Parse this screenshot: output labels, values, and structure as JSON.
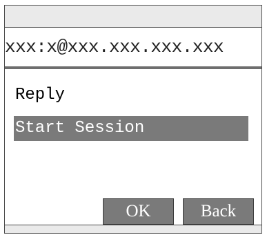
{
  "header": {
    "address": "xxx:x@xxx.xxx.xxx.xxx"
  },
  "menu": {
    "items": [
      {
        "label": "Reply",
        "selected": false
      },
      {
        "label": "Start Session",
        "selected": true
      }
    ]
  },
  "softkeys": {
    "ok_label": "OK",
    "back_label": "Back"
  },
  "colors": {
    "selection": "#7a7a7a",
    "softkey": "#7a7a7a",
    "frame": "#eaeaea"
  }
}
